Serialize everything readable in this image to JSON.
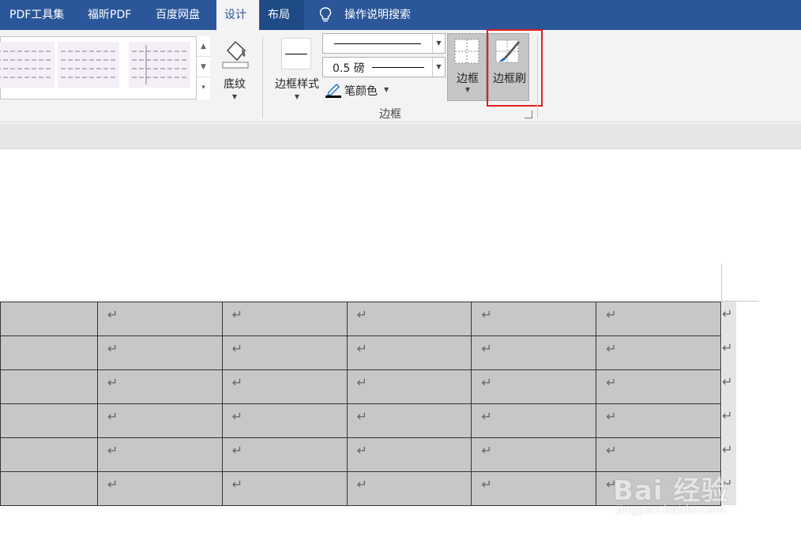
{
  "tabs": [
    {
      "label": "PDF工具集"
    },
    {
      "label": "福昕PDF"
    },
    {
      "label": "百度网盘"
    },
    {
      "label": "设计"
    },
    {
      "label": "布局"
    }
  ],
  "search": {
    "label": "操作说明搜索",
    "icon": "lightbulb-icon"
  },
  "ribbon": {
    "shading_label": "底纹",
    "border_styles_label": "边框样式",
    "pen_weight": "0.5 磅",
    "pen_color_label": "笔颜色",
    "borders_label": "边框",
    "border_painter_label": "边框刷",
    "group_label": "边框"
  },
  "table": {
    "rows": 6,
    "cols": 6,
    "cell_mark": "↵"
  },
  "watermark": {
    "main": "Bai 经验",
    "sub": "jingyan.baidu.com"
  },
  "colors": {
    "tabbar": "#2b579a",
    "table_fill": "#c7c7c7",
    "highlight": "#e02020"
  }
}
